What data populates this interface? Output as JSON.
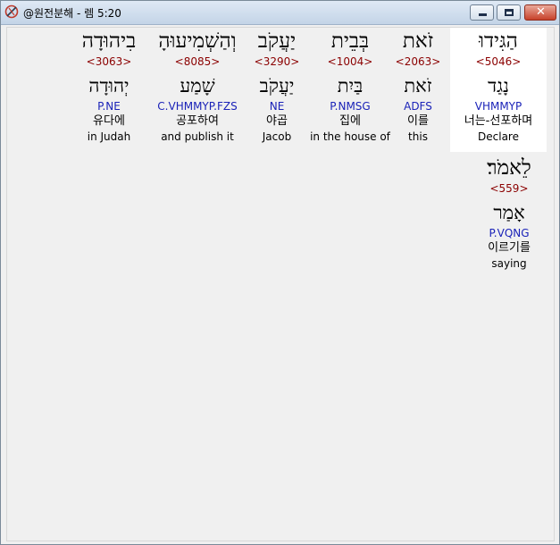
{
  "window": {
    "title": "@원전분해 - 렘 5:20",
    "icon": "app-logo-icon",
    "buttons": {
      "minimize": "minimize-icon",
      "maximize": "maximize-icon",
      "close": "close-icon"
    }
  },
  "colors": {
    "strong_number": "#8b0000",
    "morphology": "#1a22b8",
    "selected_background": "#ffffff",
    "client_background": "#f0f0f0"
  },
  "words": [
    {
      "hebrew": "הַגִּידוּ",
      "strong": "<5046>",
      "lexeme": "נָגַד",
      "morph": "VHMMYP",
      "korean": "너는-선포하며",
      "english": "Declare",
      "selected": true
    },
    {
      "hebrew": "זֹאת",
      "strong": "<2063>",
      "lexeme": "זֹאת",
      "morph": "ADFS",
      "korean": "이를",
      "english": "this",
      "selected": false
    },
    {
      "hebrew": "בְּבֵית",
      "strong": "<1004>",
      "lexeme": "בַּיִת",
      "morph": "P.NMSG",
      "korean": "집에",
      "english": "in the house of",
      "selected": false
    },
    {
      "hebrew": "יַעֲקֹב",
      "strong": "<3290>",
      "lexeme": "יַעֲקֹב",
      "morph": "NE",
      "korean": "야곱",
      "english": "Jacob",
      "selected": false
    },
    {
      "hebrew": "וְהַשְׁמִיעוּהָ",
      "strong": "<8085>",
      "lexeme": "שָׁמַע",
      "morph": "C.VHMMYP.FZS",
      "korean": "공포하여",
      "english": "and publish it",
      "selected": false
    },
    {
      "hebrew": "בִיהוּדָה",
      "strong": "<3063>",
      "lexeme": "יְהוּדָה",
      "morph": "P.NE",
      "korean": "유다에",
      "english": "in Judah",
      "selected": false
    },
    {
      "hebrew": "לֵאמֹר׃",
      "strong": "<559>",
      "lexeme": "אָמַר",
      "morph": "P.VQNG",
      "korean": "이르기를",
      "english": "saying",
      "selected": false
    }
  ]
}
